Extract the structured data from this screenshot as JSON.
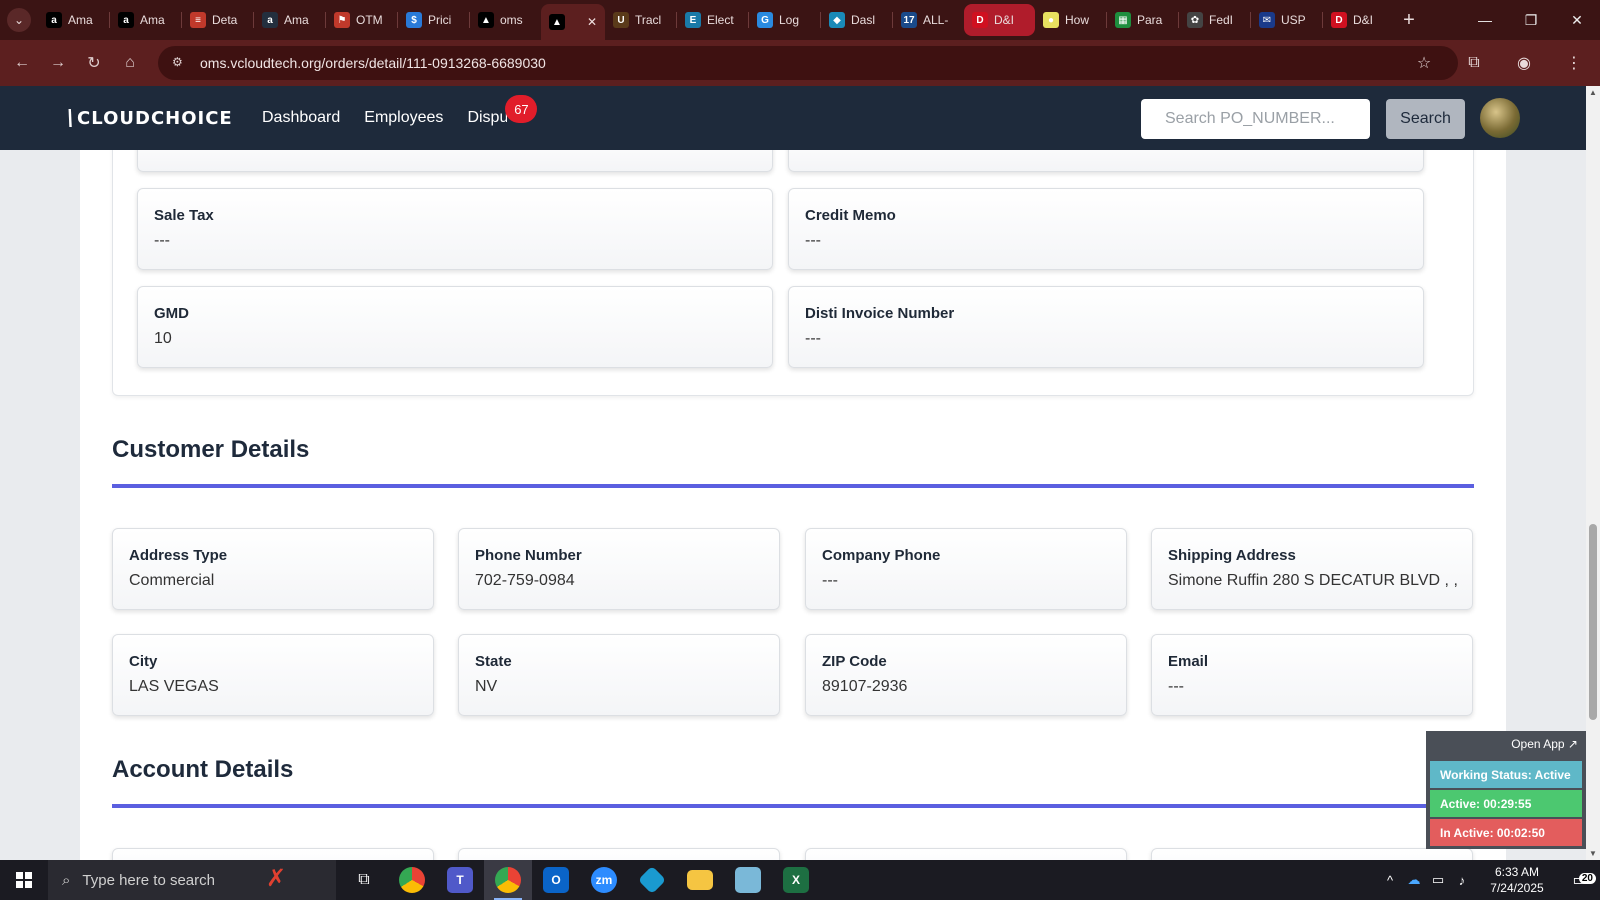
{
  "browser": {
    "tabs": [
      {
        "title": "Ama",
        "icon": "amazon-icon",
        "color": "#000000"
      },
      {
        "title": "Ama",
        "icon": "amazon-icon",
        "color": "#000000"
      },
      {
        "title": "Deta",
        "icon": "flag-icon",
        "color": "#c0392b"
      },
      {
        "title": "Ama",
        "icon": "amazon-icon",
        "color": "#232f3e"
      },
      {
        "title": "OTM",
        "icon": "otm-icon",
        "color": "#c0392b"
      },
      {
        "title": "Prici",
        "icon": "dollar-icon",
        "color": "#2a7ad8"
      },
      {
        "title": "oms",
        "icon": "cloudchoice-icon",
        "color": "#000000"
      },
      {
        "title": "",
        "icon": "cloudchoice-icon",
        "color": "#000000"
      },
      {
        "title": "Tracl",
        "icon": "ups-icon",
        "color": "#5a3a1a"
      },
      {
        "title": "Elect",
        "icon": "eg-icon",
        "color": "#1a7aa8"
      },
      {
        "title": "Log",
        "icon": "g-icon",
        "color": "#2a8ae0"
      },
      {
        "title": "Dasl",
        "icon": "diamond-icon",
        "color": "#1a8ab8"
      },
      {
        "title": "ALL-",
        "icon": "seventeen-icon",
        "color": "#1a4a8a"
      },
      {
        "title": "D&I",
        "icon": "dh-icon",
        "color": "#d01020"
      },
      {
        "title": "How",
        "icon": "circle-icon",
        "color": "#e8e060"
      },
      {
        "title": "Para",
        "icon": "sheet-icon",
        "color": "#1e8e3e"
      },
      {
        "title": "FedI",
        "icon": "openai-icon",
        "color": "#444444"
      },
      {
        "title": "USP",
        "icon": "mail-icon",
        "color": "#1a3a8a"
      },
      {
        "title": "D&I",
        "icon": "dh-icon",
        "color": "#d01020"
      }
    ],
    "url": "oms.vcloudtech.org/orders/detail/111-0913268-6689030"
  },
  "app": {
    "logo_text": "CLOUDCHOICE",
    "nav": {
      "dashboard": "Dashboard",
      "employees": "Employees",
      "disputes": "Disputes",
      "disputes_count": "67"
    },
    "search": {
      "placeholder": "Search PO_NUMBER...",
      "button": "Search"
    }
  },
  "order_fields": [
    {
      "label": "Sale Tax",
      "value": "---"
    },
    {
      "label": "Credit Memo",
      "value": "---"
    },
    {
      "label": "GMD",
      "value": "10"
    },
    {
      "label": "Disti Invoice Number",
      "value": "---"
    }
  ],
  "customer_details": {
    "title": "Customer Details",
    "fields": [
      {
        "label": "Address Type",
        "value": "Commercial"
      },
      {
        "label": "Phone Number",
        "value": "702-759-0984"
      },
      {
        "label": "Company Phone",
        "value": "---"
      },
      {
        "label": "Shipping Address",
        "value": "Simone Ruffin 280 S DECATUR BLVD , ,"
      },
      {
        "label": "City",
        "value": "LAS VEGAS"
      },
      {
        "label": "State",
        "value": "NV"
      },
      {
        "label": "ZIP Code",
        "value": "89107-2936"
      },
      {
        "label": "Email",
        "value": "---"
      }
    ]
  },
  "account_details": {
    "title": "Account Details"
  },
  "status_widget": {
    "open_app": "Open App ↗",
    "working_status": "Working Status: Active",
    "active": "Active: 00:29:55",
    "inactive": "In Active: 00:02:50"
  },
  "taskbar": {
    "search_placeholder": "Type here to search",
    "time": "6:33 AM",
    "date": "7/24/2025",
    "notifications": "20"
  }
}
